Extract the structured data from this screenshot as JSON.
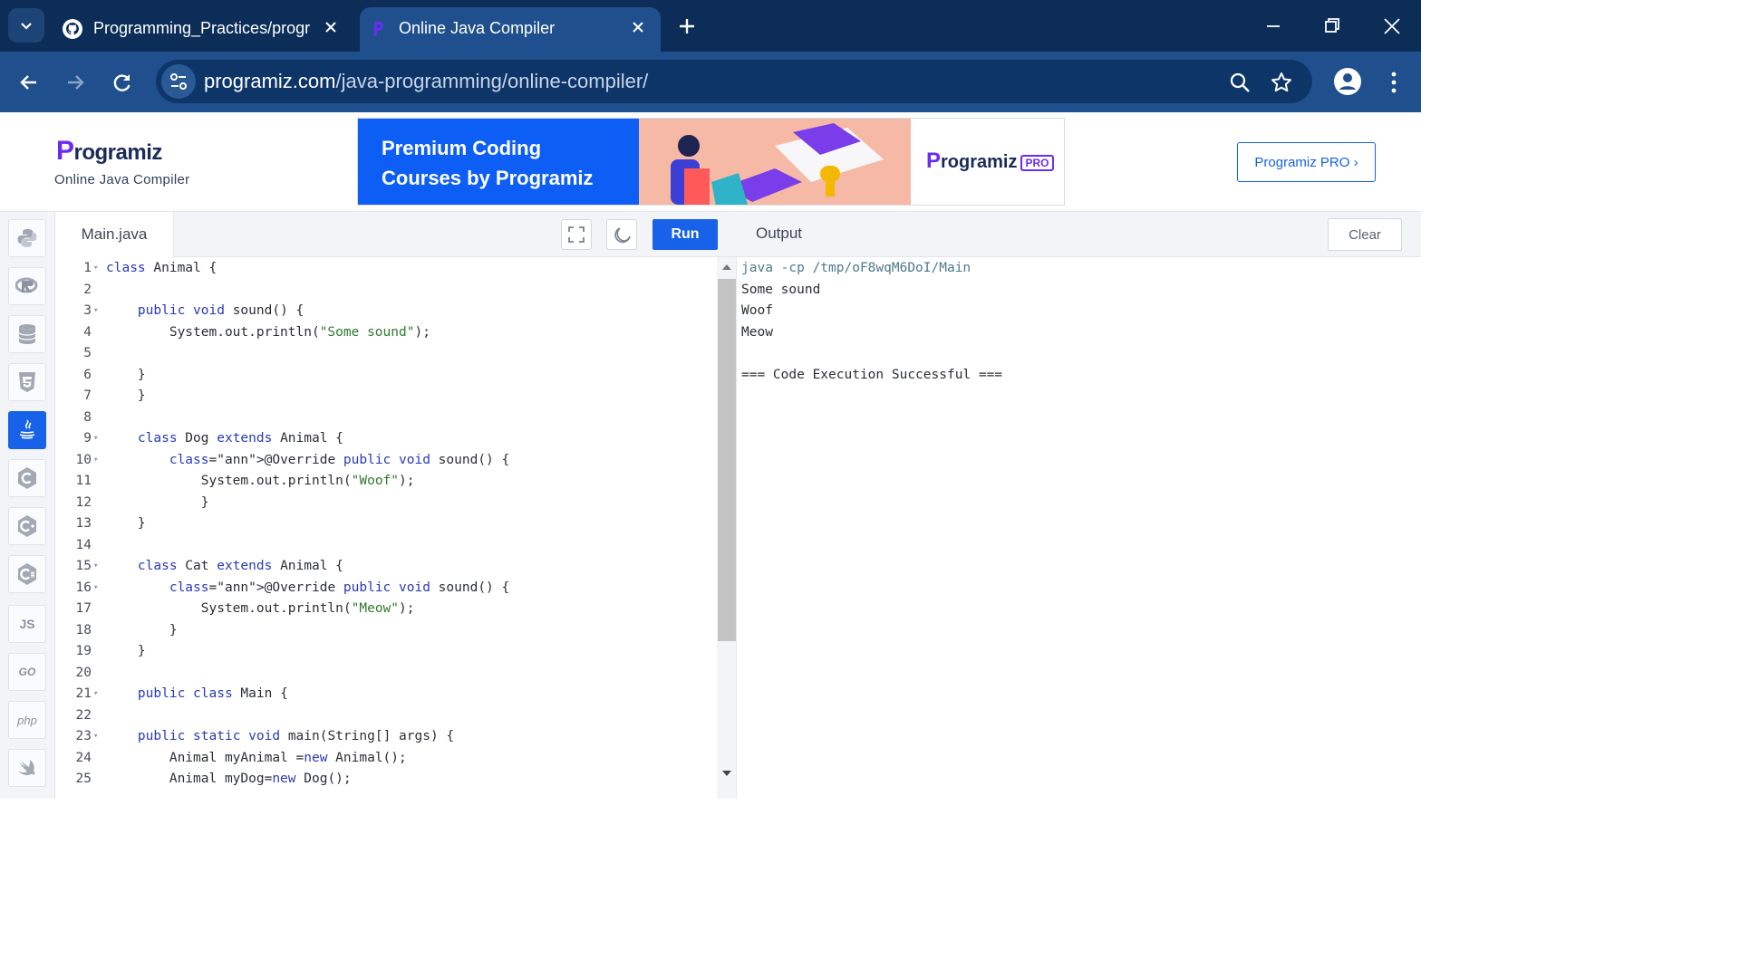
{
  "browser": {
    "tabs": [
      {
        "title": "Programming_Practices/prograr",
        "icon": "github-icon",
        "active": false
      },
      {
        "title": "Online Java Compiler",
        "icon": "programiz-favicon",
        "active": true
      }
    ],
    "url_host": "programiz.com",
    "url_path": "/java-programming/online-compiler/"
  },
  "site": {
    "logo": "rogramiz",
    "logo_p": "P",
    "subtitle": "Online Java Compiler",
    "banner_headline": "Premium Coding Courses by Programiz",
    "banner_logo": "rogramiz",
    "banner_logo_p": "P",
    "banner_badge": "PRO",
    "pro_button": "Programiz PRO ›"
  },
  "sidebar": {
    "languages": [
      {
        "name": "python-icon",
        "label": "",
        "active": false
      },
      {
        "name": "r-icon",
        "label": "",
        "active": false
      },
      {
        "name": "sql-icon",
        "label": "",
        "active": false
      },
      {
        "name": "html-icon",
        "label": "",
        "active": false
      },
      {
        "name": "java-icon",
        "label": "",
        "active": true
      },
      {
        "name": "c-icon",
        "label": "",
        "active": false
      },
      {
        "name": "cpp-icon",
        "label": "",
        "active": false
      },
      {
        "name": "csharp-icon",
        "label": "",
        "active": false
      },
      {
        "name": "js-icon",
        "label": "JS",
        "active": false
      },
      {
        "name": "go-icon",
        "label": "GO",
        "active": false
      },
      {
        "name": "php-icon",
        "label": "php",
        "active": false
      },
      {
        "name": "swift-icon",
        "label": "",
        "active": false
      }
    ]
  },
  "editor": {
    "file_name": "Main.java",
    "run_label": "Run",
    "lines": [
      "class Animal {",
      "",
      "    public void sound() {",
      "        System.out.println(\"Some sound\");",
      "",
      "    }",
      "    }",
      "",
      "    class Dog extends Animal {",
      "        @Override public void sound() {",
      "            System.out.println(\"Woof\");",
      "            }",
      "    }",
      "",
      "    class Cat extends Animal {",
      "        @Override public void sound() {",
      "            System.out.println(\"Meow\");",
      "        }",
      "    }",
      "",
      "    public class Main {",
      "",
      "    public static void main(String[] args) {",
      "        Animal myAnimal =new Animal();",
      "        Animal myDog=new Dog();"
    ],
    "fold_lines": [
      1,
      3,
      9,
      10,
      15,
      16,
      21,
      23
    ]
  },
  "output": {
    "title": "Output",
    "clear_label": "Clear",
    "lines": [
      "java -cp /tmp/oF8wqM6DoI/Main",
      "Some sound",
      "Woof",
      "Meow",
      "",
      "=== Code Execution Successful ==="
    ]
  },
  "colors": {
    "accent": "#1762e8",
    "tabstrip": "#0b2d58",
    "toolbar": "#1f4f8c",
    "keyword": "#2a3ab7",
    "string": "#2f7a2f"
  }
}
